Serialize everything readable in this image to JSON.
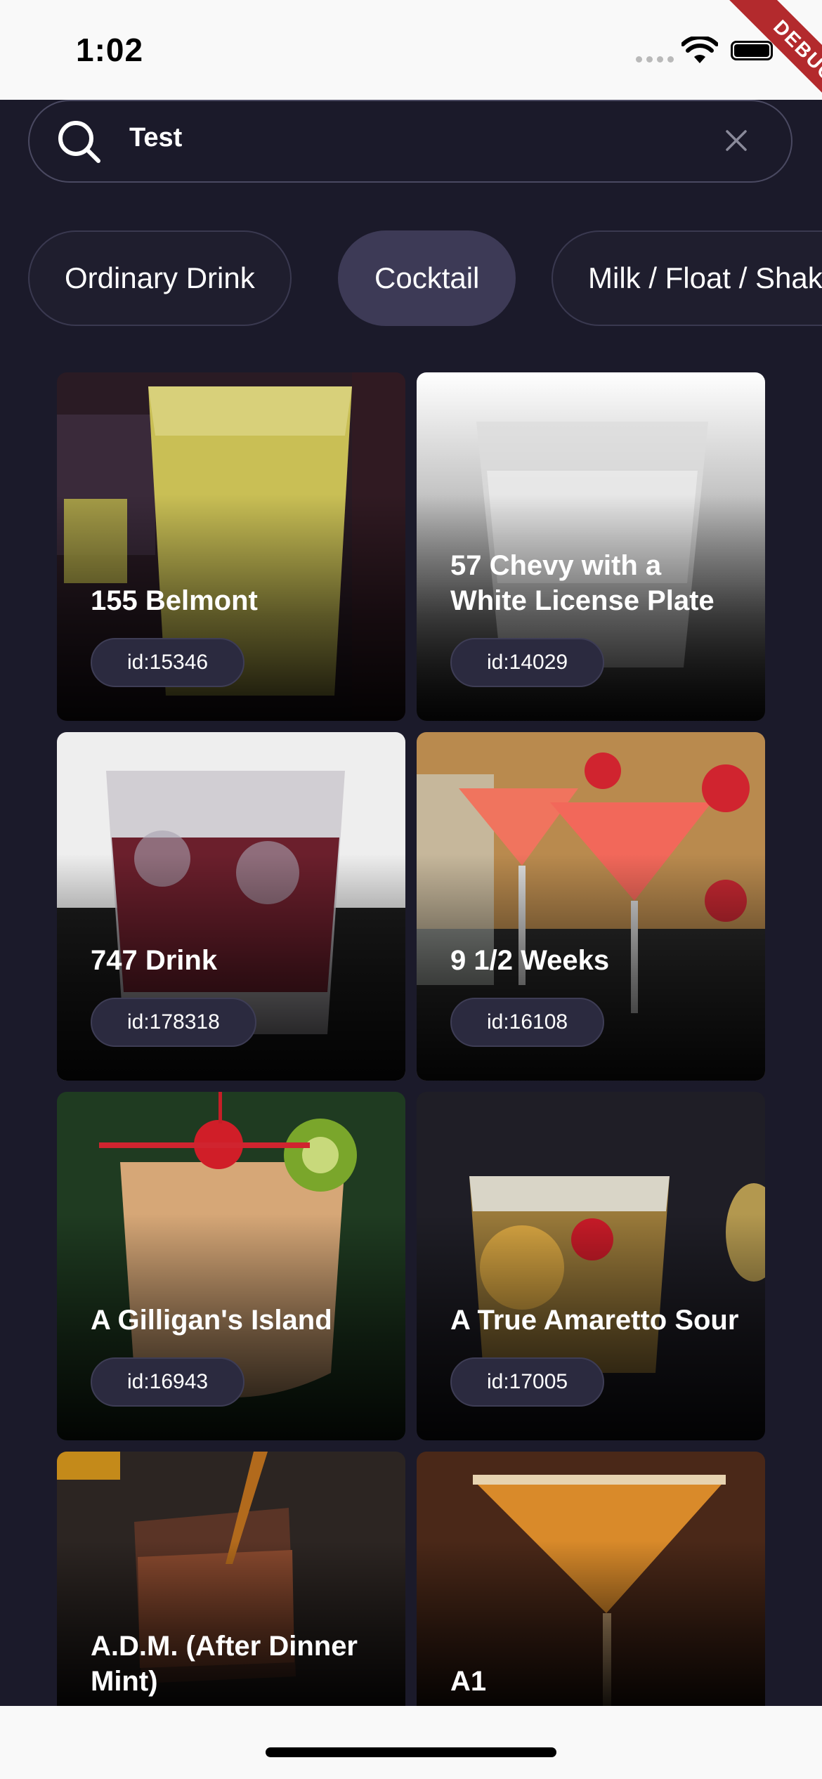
{
  "status": {
    "time": "1:02",
    "debug_label": "DEBUG"
  },
  "search": {
    "value": "Test"
  },
  "categories": [
    "Ordinary Drink",
    "Cocktail",
    "Milk / Float / Shake"
  ],
  "selected_category": "Cocktail",
  "drinks": [
    {
      "name": "155 Belmont",
      "id": "id:15346"
    },
    {
      "name": "57 Chevy with a White License Plate",
      "id": "id:14029"
    },
    {
      "name": "747 Drink",
      "id": "id:178318"
    },
    {
      "name": "9 1/2 Weeks",
      "id": "id:16108"
    },
    {
      "name": "A Gilligan's Island",
      "id": "id:16943"
    },
    {
      "name": "A True Amaretto Sour",
      "id": "id:17005"
    },
    {
      "name": "A.D.M. (After Dinner Mint)",
      "id": ""
    },
    {
      "name": "A1",
      "id": ""
    }
  ],
  "colors": {
    "background": "#1b1a2a",
    "chip_selected": "#3d3a56",
    "pill": "#2b2a3f"
  }
}
